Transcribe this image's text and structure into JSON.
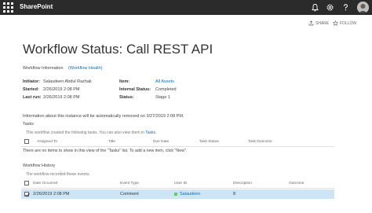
{
  "suitebar": {
    "brand": "SharePoint",
    "icons": [
      "waffle-icon",
      "bell-icon",
      "gear-icon",
      "help-icon"
    ]
  },
  "actions": {
    "share_label": "SHARE",
    "follow_label": "FOLLOW"
  },
  "page": {
    "title": "Workflow Status: Call REST API"
  },
  "workflow_info": {
    "label": "Workflow Information",
    "health_link": "(Workflow Health)",
    "left": [
      {
        "key": "Initiator:",
        "value": "Salaudeen Abdul Razhak"
      },
      {
        "key": "Started:",
        "value": "2/26/2019 2:08 PM"
      },
      {
        "key": "Last run:",
        "value": "2/26/2019 2:08 PM"
      }
    ],
    "right": [
      {
        "key": "Item:",
        "value": "All Assets",
        "is_link": true
      },
      {
        "key": "Internal Status:",
        "value": "Completed"
      },
      {
        "key": "Status:",
        "value": "Stage 1"
      }
    ]
  },
  "notice": "Information about this instance will be automatically removed on 3/27/2019 2:08 PM.",
  "tasks": {
    "heading": "Tasks",
    "description_prefix": "This workflow created the following tasks. You can also view them in",
    "description_link": "Tasks",
    "description_suffix": ".",
    "columns": [
      "Assigned To",
      "Title",
      "Due Date",
      "Task Status",
      "Task Outcome"
    ],
    "empty_message": "There are no items to show in this view of the \"Tasks\" list. To add a new item, click \"New\"."
  },
  "history": {
    "heading": "Workflow History",
    "description": "The workflow recorded these events.",
    "columns": [
      "Date Occurred",
      "Event Type",
      "User ID",
      "Description",
      "Outcome"
    ],
    "rows": [
      {
        "date": "2/26/2019 2:08 PM",
        "event": "Comment",
        "user": "Salaudeen",
        "description": "8",
        "outcome": "",
        "selected": true
      }
    ]
  },
  "colors": {
    "suitebar": "#2b2b2b",
    "link": "#0072c6",
    "selection": "#cde6f7",
    "presence": "#5dd255"
  }
}
